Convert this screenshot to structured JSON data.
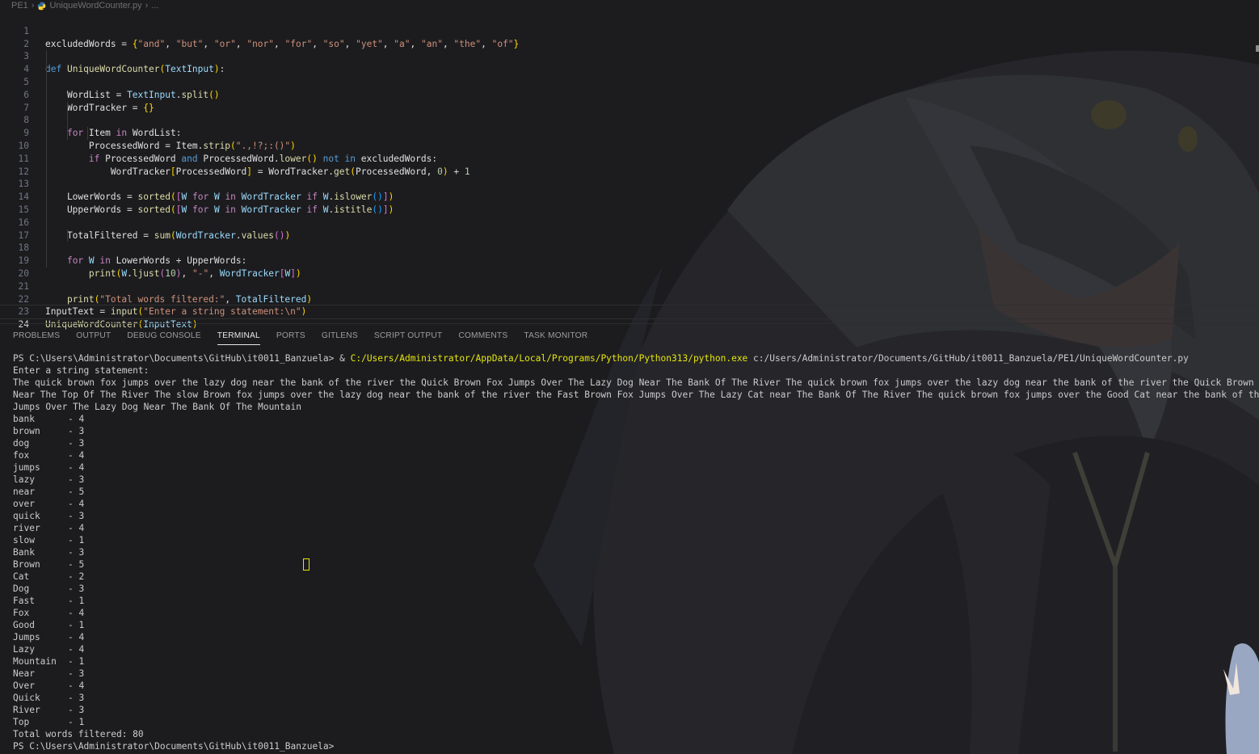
{
  "breadcrumb": {
    "folder": "PE1",
    "file": "UniqueWordCounter.py",
    "more": "..."
  },
  "editor": {
    "current_line": 24,
    "line_numbers": [
      "1",
      "2",
      "3",
      "4",
      "5",
      "6",
      "7",
      "8",
      "9",
      "10",
      "11",
      "12",
      "13",
      "14",
      "15",
      "16",
      "17",
      "18",
      "19",
      "20",
      "21",
      "22",
      "23",
      "24"
    ]
  },
  "panel_tabs": [
    "PROBLEMS",
    "OUTPUT",
    "DEBUG CONSOLE",
    "TERMINAL",
    "PORTS",
    "GITLENS",
    "SCRIPT OUTPUT",
    "COMMENTS",
    "TASK MONITOR"
  ],
  "active_tab": "TERMINAL",
  "terminal": {
    "command_prompt": "PS C:\\Users\\Administrator\\Documents\\GitHub\\it0011_Banzuela> & ",
    "command_exe": "C:/Users/Administrator/AppData/Local/Programs/Python/Python313/python.exe",
    "command_arg": " c:/Users/Administrator/Documents/GitHub/it0011_Banzuela/PE1/UniqueWordCounter.py",
    "prompt_text": "Enter a string statement:",
    "input_lines": [
      "The quick brown fox jumps over the lazy dog near the bank of the river the Quick Brown Fox Jumps Over The Lazy Dog Near The Bank Of The River The quick brown fox jumps over the lazy dog near the bank of the river the Quick Brown Fox Jumps Over The Lazy Dog",
      "Near The Top Of The River The slow Brown fox jumps over the lazy dog near the bank of the river the Fast Brown Fox Jumps Over The Lazy Cat near The Bank Of The River The quick brown fox jumps over the Good Cat near the bank of the river the Quick Brown Fox",
      "Jumps Over The Lazy Dog Near The Bank Of The Mountain"
    ],
    "word_counts": [
      {
        "word": "bank",
        "count": "4"
      },
      {
        "word": "brown",
        "count": "3"
      },
      {
        "word": "dog",
        "count": "3"
      },
      {
        "word": "fox",
        "count": "4"
      },
      {
        "word": "jumps",
        "count": "4"
      },
      {
        "word": "lazy",
        "count": "3"
      },
      {
        "word": "near",
        "count": "5"
      },
      {
        "word": "over",
        "count": "4"
      },
      {
        "word": "quick",
        "count": "3"
      },
      {
        "word": "river",
        "count": "4"
      },
      {
        "word": "slow",
        "count": "1"
      },
      {
        "word": "Bank",
        "count": "3"
      },
      {
        "word": "Brown",
        "count": "5"
      },
      {
        "word": "Cat",
        "count": "2"
      },
      {
        "word": "Dog",
        "count": "3"
      },
      {
        "word": "Fast",
        "count": "1"
      },
      {
        "word": "Fox",
        "count": "4"
      },
      {
        "word": "Good",
        "count": "1"
      },
      {
        "word": "Jumps",
        "count": "4"
      },
      {
        "word": "Lazy",
        "count": "4"
      },
      {
        "word": "Mountain",
        "count": "1"
      },
      {
        "word": "Near",
        "count": "3"
      },
      {
        "word": "Over",
        "count": "4"
      },
      {
        "word": "Quick",
        "count": "3"
      },
      {
        "word": "River",
        "count": "3"
      },
      {
        "word": "Top",
        "count": "1"
      }
    ],
    "total_line": "Total words filtered: 80",
    "final_prompt": "PS C:\\Users\\Administrator\\Documents\\GitHub\\it0011_Banzuela>"
  }
}
